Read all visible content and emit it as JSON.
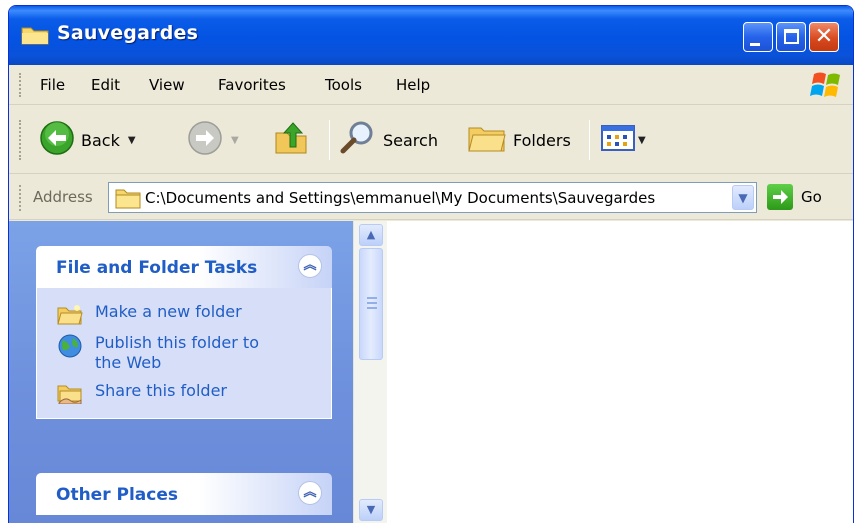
{
  "window": {
    "title": "Sauvegardes"
  },
  "menubar": {
    "items": [
      "File",
      "Edit",
      "View",
      "Favorites",
      "Tools",
      "Help"
    ]
  },
  "toolbar": {
    "back_label": "Back",
    "search_label": "Search",
    "folders_label": "Folders"
  },
  "address": {
    "label": "Address",
    "value": "C:\\Documents and Settings\\emmanuel\\My Documents\\Sauvegardes",
    "go_label": "Go"
  },
  "taskpane": {
    "file_tasks": {
      "title": "File and Folder Tasks",
      "items": [
        "Make a new folder",
        "Publish this folder to the Web",
        "Share this folder"
      ]
    },
    "other_places": {
      "title": "Other Places"
    }
  },
  "colors": {
    "titlebar_blue": "#0453e3",
    "taskpane_blue": "#7ba2e7",
    "link_blue": "#215dc6",
    "close_red": "#d94a1f"
  }
}
